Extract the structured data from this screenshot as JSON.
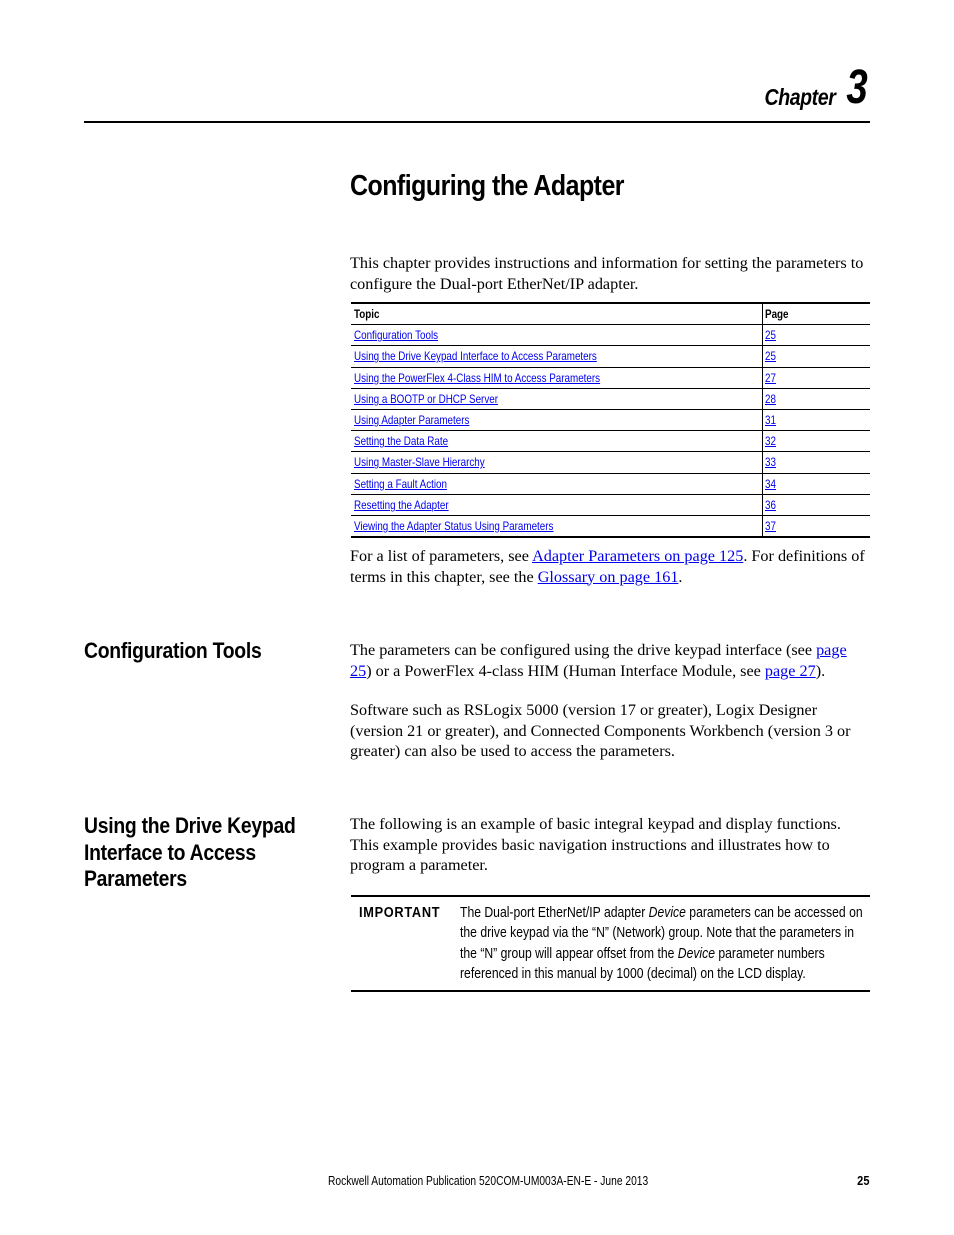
{
  "header": {
    "chapter_word": "Chapter",
    "chapter_number": "3"
  },
  "title": "Configuring the Adapter",
  "intro": "This chapter provides instructions and information for setting the parameters to configure the Dual-port EtherNet/IP adapter.",
  "toc": {
    "headers": {
      "topic": "Topic",
      "page": "Page"
    },
    "rows": [
      {
        "topic": "Configuration Tools",
        "page": "25"
      },
      {
        "topic": "Using the Drive Keypad Interface to Access Parameters",
        "page": "25"
      },
      {
        "topic": "Using the PowerFlex 4-Class HIM to Access Parameters",
        "page": "27"
      },
      {
        "topic": "Using a BOOTP or DHCP Server",
        "page": "28"
      },
      {
        "topic": "Using Adapter Parameters",
        "page": "31"
      },
      {
        "topic": "Setting the Data Rate",
        "page": "32"
      },
      {
        "topic": "Using Master-Slave Hierarchy",
        "page": "33"
      },
      {
        "topic": "Setting a Fault Action",
        "page": "34"
      },
      {
        "topic": "Resetting the Adapter",
        "page": "36"
      },
      {
        "topic": "Viewing the Adapter Status Using Parameters",
        "page": "37"
      }
    ]
  },
  "references": {
    "prefix": "For a list of parameters, see ",
    "link1": "Adapter Parameters on page 125",
    "middle": ". For definitions of terms in this chapter, see the ",
    "link2": "Glossary on page 161",
    "suffix": "."
  },
  "sections": [
    {
      "heading": "Configuration Tools",
      "paragraphs": [
        {
          "p1_prefix": "The parameters can be configured using the drive keypad interface (see ",
          "p1_link1": "page 25",
          "p1_middle": ") or a PowerFlex 4-class HIM (Human Interface Module, see ",
          "p1_link2": "page 27",
          "p1_suffix": ")."
        },
        {
          "text": "Software such as RSLogix 5000 (version 17 or greater), Logix Designer (version 21 or greater), and Connected Components Workbench (version 3 or greater) can also be used to access the parameters."
        }
      ]
    },
    {
      "heading": "Using the Drive Keypad Interface to Access Parameters",
      "paragraphs": [
        {
          "text": "The following is an example of basic integral keypad and display functions. This example provides basic navigation instructions and illustrates how to program a parameter."
        }
      ],
      "important": {
        "label": "IMPORTANT",
        "t1": "The Dual-port EtherNet/IP adapter ",
        "em1": "Device",
        "t2": " parameters can be accessed on the drive keypad via the “N” (Network) group. Note that the parameters in the “N” group will appear offset from the ",
        "em2": "Device",
        "t3": " parameter numbers referenced in this manual by 1000 (decimal) on the LCD display."
      }
    }
  ],
  "footer": {
    "publication": "Rockwell Automation Publication 520COM-UM003A-EN-E - June 2013",
    "page_number": "25"
  }
}
